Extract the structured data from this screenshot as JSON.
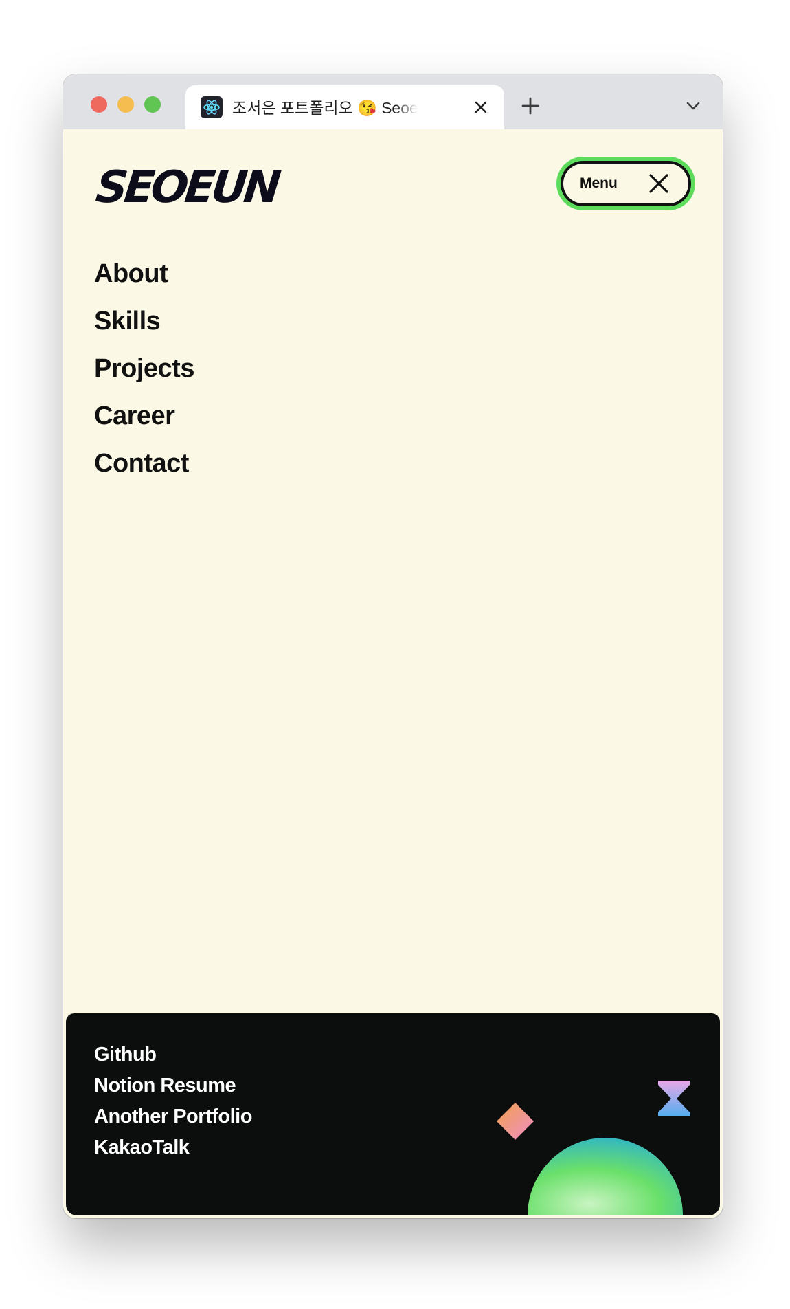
{
  "browser": {
    "tab_title": "조서은 포트폴리오 😘 Seoeun-Portfolio"
  },
  "header": {
    "logo": "SEOEUN",
    "menu_label": "Menu"
  },
  "nav": {
    "items": [
      "About",
      "Skills",
      "Projects",
      "Career",
      "Contact"
    ]
  },
  "footer": {
    "links": [
      "Github",
      "Notion Resume",
      "Another Portfolio",
      "KakaoTalk"
    ]
  },
  "colors": {
    "background": "#fbf9e6",
    "accent_green": "#5ddc5c",
    "footer_bg": "#0c0e0e"
  }
}
